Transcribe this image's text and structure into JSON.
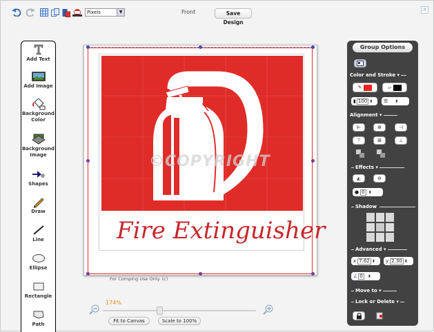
{
  "toolbar": {
    "unit_select": "Pixels",
    "view_label": "Front",
    "save_label": "Save Design",
    "close_label": "X"
  },
  "tools": [
    {
      "label": "Add Text",
      "icon": "text-tool-icon"
    },
    {
      "label": "Add Image",
      "icon": "image-icon"
    },
    {
      "label": "Background Color",
      "icon": "paint-bucket-icon"
    },
    {
      "label": "Background Image",
      "icon": "background-image-icon"
    },
    {
      "label": "Shapes",
      "icon": "shapes-icon"
    },
    {
      "label": "Draw",
      "icon": "pencil-icon"
    },
    {
      "label": "Line",
      "icon": "line-icon"
    },
    {
      "label": "Ellipse",
      "icon": "ellipse-icon"
    },
    {
      "label": "Rectangle",
      "icon": "rectangle-icon"
    },
    {
      "label": "Path",
      "icon": "path-icon"
    }
  ],
  "canvas": {
    "product_text": "Fire Extinguisher",
    "watermark": "©COPYRIGHT",
    "footer_text": "For Comping Use Only. (c)",
    "accent_color": "#e02c28"
  },
  "zoom": {
    "percent": "174%",
    "fit_label": "Fit to Canvas",
    "scale_label": "Scale to 100%"
  },
  "group_options": {
    "title": "Group Options",
    "color_stroke": "Color and Stroke",
    "opacity_value": "100",
    "alignment": "Alignment",
    "effects": "Effects",
    "effect_value": "0",
    "shadow": "Shadow",
    "advanced": "Advanced",
    "x_label": "x",
    "x_value": "7.62",
    "y_label": "y",
    "y_value": "2.30",
    "rotate_value": "0",
    "move_to": "Move to",
    "lock_delete": "Lock or Delete",
    "fill_color": "#e8231d",
    "stroke_color": "#000000"
  }
}
